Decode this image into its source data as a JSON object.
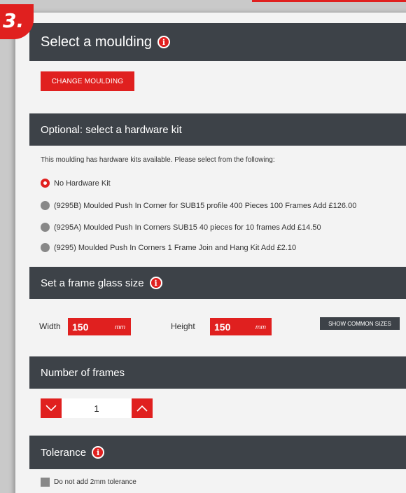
{
  "step_number": "3.",
  "moulding": {
    "title": "Select a moulding",
    "change_button": "CHANGE MOULDING"
  },
  "hardware": {
    "title": "Optional: select a hardware kit",
    "description": "This moulding has hardware kits available. Please select from the following:",
    "options": [
      {
        "label": "No Hardware Kit",
        "selected": true
      },
      {
        "label": "(9295B) Moulded Push In Corner for SUB15 profile 400 Pieces 100 Frames Add £126.00",
        "selected": false
      },
      {
        "label": "(9295A) Moulded Push In Corners SUB15 40 pieces for 10 frames Add £14.50",
        "selected": false
      },
      {
        "label": "(9295) Moulded Push In Corners 1 Frame Join and Hang Kit Add £2.10",
        "selected": false
      }
    ]
  },
  "glass": {
    "title": "Set a frame glass size",
    "width_label": "Width",
    "width_value": "150",
    "height_label": "Height",
    "height_value": "150",
    "unit": "mm",
    "common_sizes_button": "SHOW COMMON SIZES"
  },
  "frames": {
    "title": "Number of frames",
    "quantity": "1"
  },
  "tolerance": {
    "title": "Tolerance",
    "checkbox_label": "Do not add 2mm tolerance"
  },
  "colors": {
    "accent": "#e0201f",
    "header_bg": "#3d4248",
    "panel_bg": "#f3f3f3"
  }
}
